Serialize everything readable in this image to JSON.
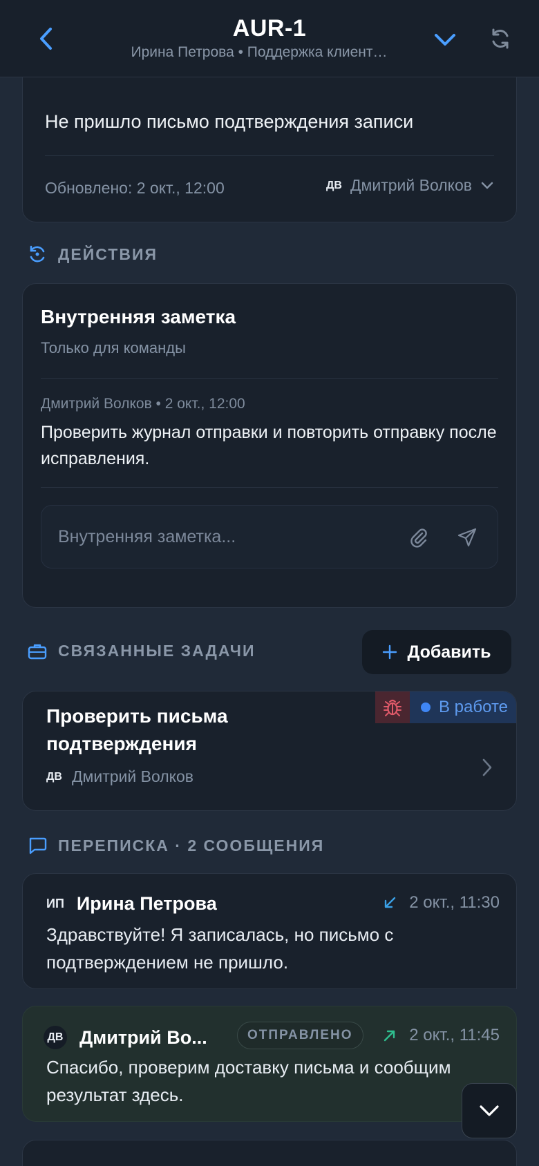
{
  "header": {
    "title": "AUR-1",
    "subtitle": "Ирина Петрова • Поддержка клиент…"
  },
  "ticket": {
    "description": "Не пришло письмо подтверждения записи",
    "updated": "Обновлено: 2 окт., 12:00",
    "assignee_initials": "ДВ",
    "assignee_name": "Дмитрий Волков"
  },
  "actions_section": {
    "title": "ДЕЙСТВИЯ"
  },
  "internal_note": {
    "title": "Внутренняя заметка",
    "subtitle": "Только для команды",
    "meta": "Дмитрий Волков • 2 окт., 12:00",
    "text": "Проверить журнал отправки и повторить отправку после исправления.",
    "input_placeholder": "Внутренняя заметка..."
  },
  "linked_tasks": {
    "title": "СВЯЗАННЫЕ ЗАДАЧИ",
    "add_label": "Добавить",
    "items": [
      {
        "title": "Проверить письма подтверждения",
        "assignee_initials": "ДВ",
        "assignee_name": "Дмитрий Волков",
        "status": "В работе",
        "type_icon": "bug-icon"
      }
    ]
  },
  "conversation": {
    "title": "ПЕРЕПИСКА · 2 СООБЩЕНИЯ",
    "messages": [
      {
        "initials": "ИП",
        "author": "Ирина Петрова",
        "direction": "incoming",
        "time": "2 окт., 11:30",
        "text": "Здравствуйте! Я записалась, но письмо с подтверждением не пришло."
      },
      {
        "initials": "ДВ",
        "author": "Дмитрий Во...",
        "direction": "outgoing",
        "badge": "ОТПРАВЛЕНО",
        "time": "2 окт., 11:45",
        "text": "Спасибо, проверим доставку письма и сообщим результат здесь."
      }
    ]
  },
  "colors": {
    "accent": "#4a9eff",
    "status_blue": "#5e9bf0",
    "bug_red": "#e05a6a",
    "incoming_arrow": "#3aa0e6",
    "outgoing_arrow": "#2fbf8f"
  }
}
